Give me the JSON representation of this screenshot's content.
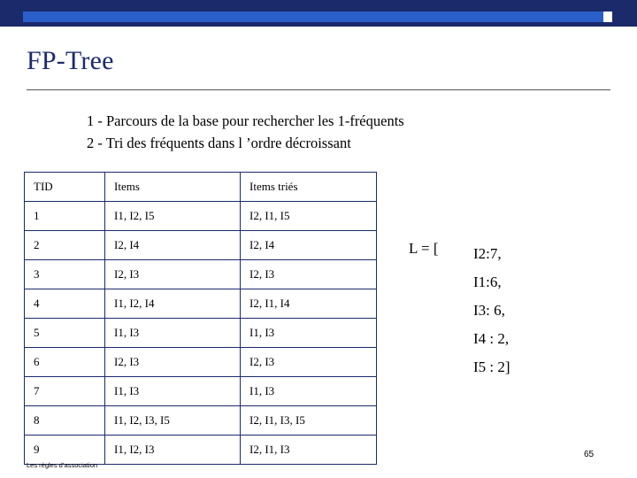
{
  "slide": {
    "title": "FP-Tree",
    "subtitle_lines": [
      "1 - Parcours de la base pour rechercher les 1-fréquents",
      "2 - Tri des fréquents dans l ’ordre décroissant"
    ],
    "footer_note": "Les règles d’association",
    "page_number": "65",
    "accent_navy": "#1b2a6b",
    "accent_blue": "#2a5fc9"
  },
  "table": {
    "headers": [
      "TID",
      "Items",
      "Items triés"
    ],
    "rows": [
      [
        "1",
        "I1, I2, I5",
        "I2, I1, I5"
      ],
      [
        "2",
        "I2, I4",
        "I2, I4"
      ],
      [
        "3",
        "I2, I3",
        "I2, I3"
      ],
      [
        "4",
        "I1, I2, I4",
        "I2, I1, I4"
      ],
      [
        "5",
        "I1, I3",
        "I1, I3"
      ],
      [
        "6",
        "I2, I3",
        "I2, I3"
      ],
      [
        "7",
        "I1, I3",
        "I1, I3"
      ],
      [
        "8",
        "I1, I2, I3, I5",
        "I2, I1, I3, I5"
      ],
      [
        "9",
        "I1, I2, I3",
        "I2, I1, I3"
      ]
    ]
  },
  "list_L": {
    "label": "L = [",
    "items": [
      "I2:7,",
      "I1:6,",
      "I3: 6,",
      "I4 : 2,",
      "I5 : 2]"
    ]
  }
}
